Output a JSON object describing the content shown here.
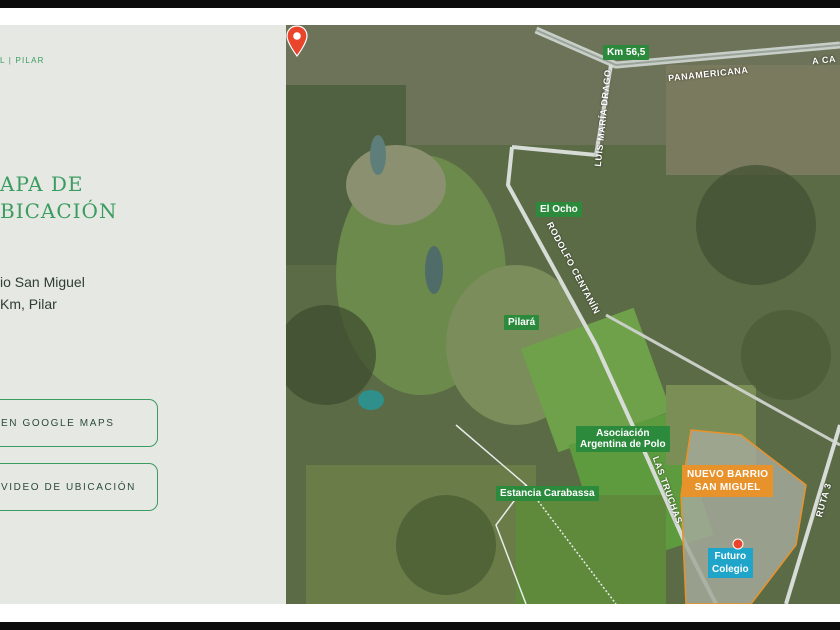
{
  "sidebar": {
    "breadcrumb": "L | PILAR",
    "title_line1": "APA DE",
    "title_line2": "BICACIÓN",
    "address_line1": "io San Miguel",
    "address_line2": "Km, Pilar",
    "button_maps": "EN GOOGLE MAPS",
    "button_video": "VIDEO DE UBICACIÓN"
  },
  "map": {
    "labels": {
      "km": "Km 56,5",
      "panamericana": "PANAMERICANA",
      "a_ca": "A CA",
      "luis_maria_drago": "LUIS MARÍA DRAGO",
      "el_ocho": "El Ocho",
      "rodolfo_centanin": "RODOLFO CENTANÍN",
      "pilara": "Pilará",
      "asociacion_line1": "Asociación",
      "asociacion_line2": "Argentina de Polo",
      "las_truchas": "LAS TRUCHAS",
      "estancia": "Estancia Carabassa",
      "barrio_line1": "NUEVO BARRIO",
      "barrio_line2": "SAN MIGUEL",
      "ruta": "RUTA 3",
      "colegio_line1": "Futuro",
      "colegio_line2": "Colegio"
    },
    "colors": {
      "label_green": "#2b8a3c",
      "barrio_orange": "#e8922b",
      "colegio_blue": "#1fa5c9",
      "pin_red": "#e8452c",
      "accent_green": "#3b9c60"
    },
    "icons": [
      "location-pin-icon"
    ]
  }
}
